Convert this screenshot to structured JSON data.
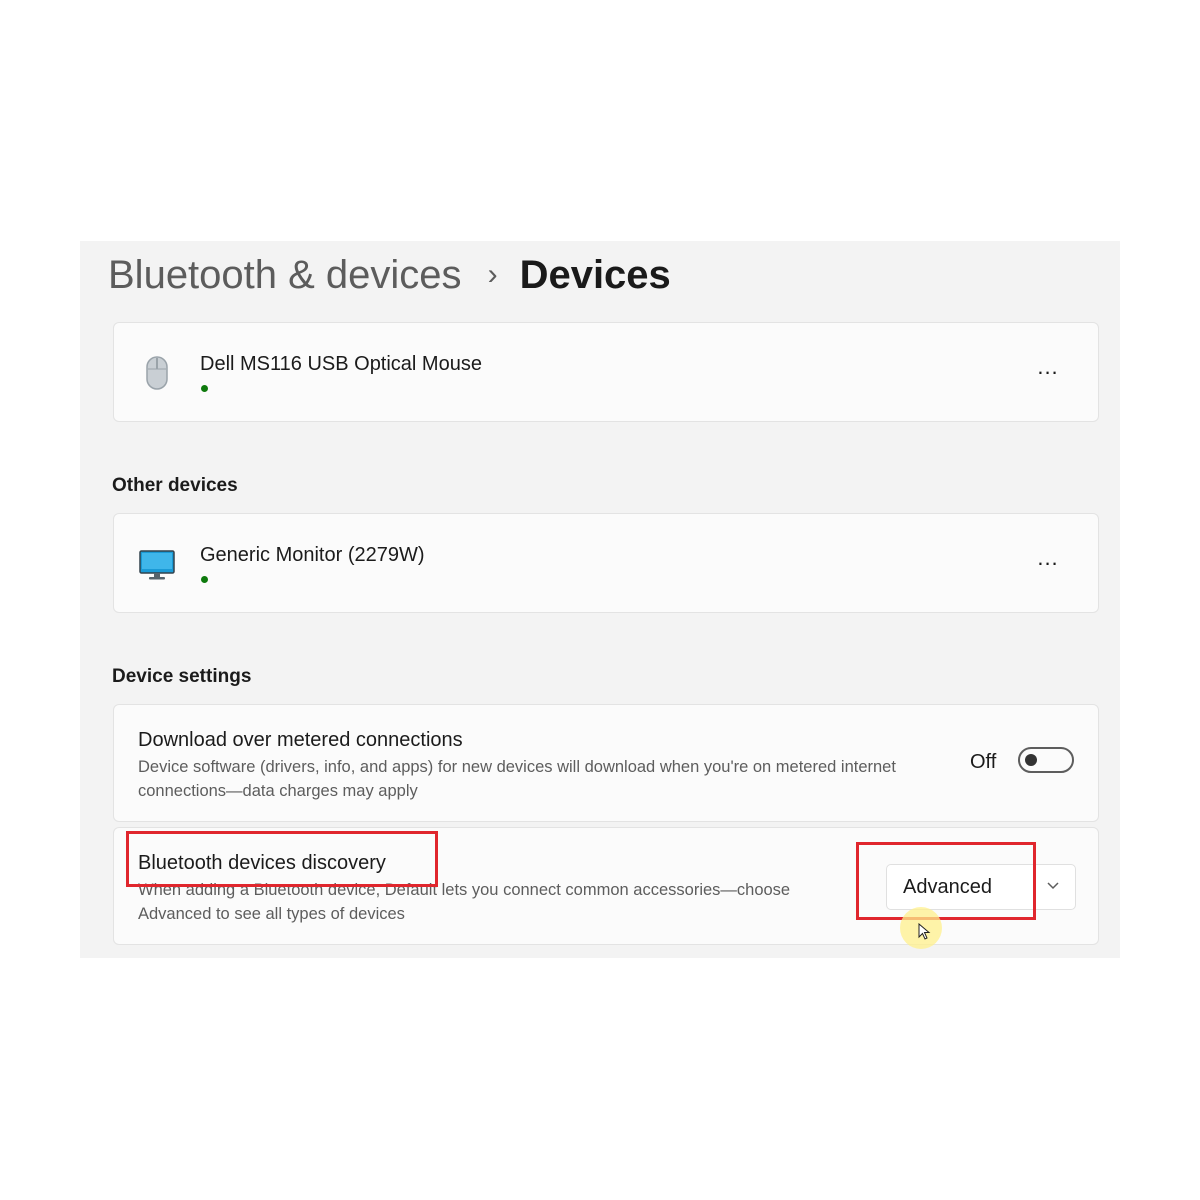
{
  "breadcrumb": {
    "parent": "Bluetooth & devices",
    "separator": "›",
    "current": "Devices"
  },
  "devices": [
    {
      "name": "Dell MS116 USB Optical Mouse",
      "icon": "mouse-icon",
      "status": "connected",
      "more_label": "..."
    }
  ],
  "other_devices": {
    "title": "Other devices",
    "items": [
      {
        "name": "Generic Monitor (2279W)",
        "icon": "monitor-icon",
        "status": "connected",
        "more_label": "..."
      }
    ]
  },
  "device_settings": {
    "title": "Device settings",
    "metered": {
      "title": "Download over metered connections",
      "description": "Device software (drivers, info, and apps) for new devices will download when you're on metered internet connections—data charges may apply",
      "toggle_label": "Off",
      "toggle_on": false
    },
    "discovery": {
      "title": "Bluetooth devices discovery",
      "description": "When adding a Bluetooth device, Default lets you connect common accessories—choose Advanced to see all types of devices",
      "dropdown_value": "Advanced"
    }
  },
  "colors": {
    "highlight": "#e0262d",
    "status_connected": "#0e7a0d",
    "panel_background": "#f3f3f3"
  }
}
